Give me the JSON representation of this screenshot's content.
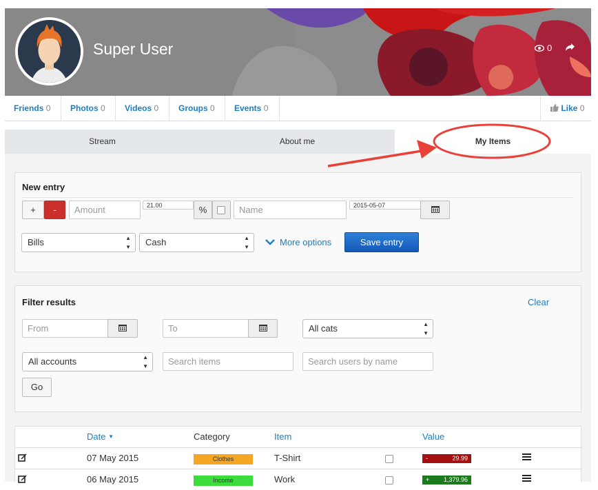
{
  "profile": {
    "name": "Super User",
    "views": "0"
  },
  "connections": [
    {
      "label": "Friends",
      "count": "0"
    },
    {
      "label": "Photos",
      "count": "0"
    },
    {
      "label": "Videos",
      "count": "0"
    },
    {
      "label": "Groups",
      "count": "0"
    },
    {
      "label": "Events",
      "count": "0"
    }
  ],
  "like": {
    "label": "Like",
    "count": "0"
  },
  "tabs": {
    "stream": "Stream",
    "about": "About me",
    "items": "My Items"
  },
  "new_entry": {
    "title": "New entry",
    "plus": "+",
    "minus": "-",
    "amount_placeholder": "Amount",
    "tax_value": "21.00",
    "percent": "%",
    "name_placeholder": "Name",
    "date_value": "2015-05-07",
    "category": "Bills",
    "account": "Cash",
    "more_options": "More options",
    "save": "Save entry"
  },
  "filter": {
    "title": "Filter results",
    "clear": "Clear",
    "from_placeholder": "From",
    "to_placeholder": "To",
    "cats": "All cats",
    "accounts": "All accounts",
    "search_items_placeholder": "Search items",
    "search_users_placeholder": "Search users by name",
    "go": "Go"
  },
  "table": {
    "headers": {
      "date": "Date",
      "category": "Category",
      "item": "Item",
      "value": "Value"
    },
    "rows": [
      {
        "date": "07 May 2015",
        "category": "Clothes",
        "item": "T-Shirt",
        "sign": "-",
        "value": "29.99"
      },
      {
        "date": "06 May 2015",
        "category": "Income",
        "item": "Work",
        "sign": "+",
        "value": "1,379.96"
      }
    ]
  },
  "colors": {
    "link": "#1a7ec4",
    "minus_btn": "#c9302c",
    "save_btn": "#1565c0",
    "annotation": "#e8413a",
    "clothes": "#f5a623",
    "income": "#3ddc3d",
    "neg": "#a4100f",
    "pos": "#1b7a1b"
  }
}
